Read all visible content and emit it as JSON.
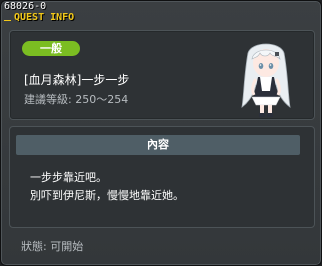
{
  "window": {
    "quest_id": "68026-0",
    "title": "QUEST INFO"
  },
  "header": {
    "category": "一般",
    "quest_name": "[血月森林]一步一步",
    "level_line": "建議等級: 250〜254",
    "npc": "npc-girl-white-hair"
  },
  "content": {
    "header_label": "內容",
    "lines": [
      "一步步靠近吧。",
      "別吓到伊尼斯，慢慢地靠近她。"
    ]
  },
  "status": {
    "text": "狀態:  可開始"
  },
  "colors": {
    "badge": "#7bbd22",
    "title": "#f3c91a",
    "content_header": "#4f5e66"
  }
}
